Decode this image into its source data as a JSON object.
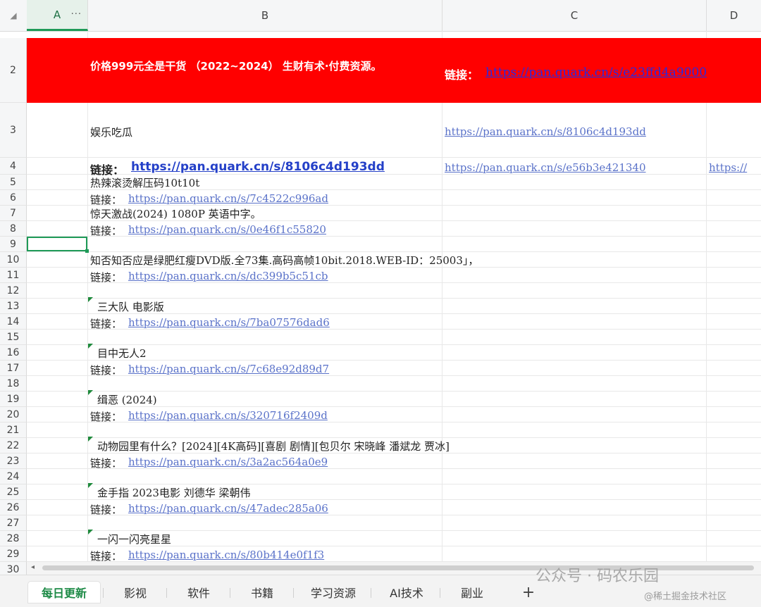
{
  "columns": [
    "A",
    "B",
    "C",
    "D"
  ],
  "col_a_menu": "···",
  "corner_icon": "◢",
  "rows": [
    "2",
    "3",
    "4",
    "5",
    "6",
    "7",
    "8",
    "9",
    "10",
    "11",
    "12",
    "13",
    "14",
    "15",
    "16",
    "17",
    "18",
    "19",
    "20",
    "21",
    "22",
    "23",
    "24",
    "25",
    "26",
    "27",
    "28",
    "29",
    "30"
  ],
  "banner": {
    "title": "价格999元全是干货 （2022~2024） 生财有术·付费资源。",
    "link_label": "链接：",
    "link_url": "https://pan.quark.cn/s/e23ffd4a9000",
    "color": "#ff0000"
  },
  "row3": {
    "text": "娱乐吃瓜",
    "c_link": "https://pan.quark.cn/s/8106c4d193dd"
  },
  "row4": {
    "label": "链接：",
    "b_link": "https://pan.quark.cn/s/8106c4d193dd",
    "c_link": "https://pan.quark.cn/s/e56b3e421340",
    "d_link": "https://"
  },
  "entries": [
    {
      "title": "热辣滚烫解压码10t10t",
      "label": "链接：",
      "url": "https://pan.quark.cn/s/7c4522c996ad"
    },
    {
      "title": "惊天激战(2024) 1080P 英语中字。",
      "label": "链接：",
      "url": "https://pan.quark.cn/s/0e46f1c55820"
    },
    {
      "title": "知否知否应是绿肥红瘦DVD版.全73集.高码高帧10bit.2018.WEB-ID：25003」，",
      "label": "链接：",
      "url": "https://pan.quark.cn/s/dc399b5c51cb"
    },
    {
      "title": "三大队 电影版",
      "label": "链接：",
      "url": "https://pan.quark.cn/s/7ba07576dad6"
    },
    {
      "title": "目中无人2",
      "label": "链接：",
      "url": "https://pan.quark.cn/s/7c68e92d89d7"
    },
    {
      "title": "缉恶 (2024)",
      "label": "链接：",
      "url": "https://pan.quark.cn/s/320716f2409d"
    },
    {
      "title": "动物园里有什么？[2024][4K高码][喜剧 剧情][包贝尔 宋晓峰 潘斌龙 贾冰]",
      "label": "链接：",
      "url": "https://pan.quark.cn/s/3a2ac564a0e9"
    },
    {
      "title": "金手指 2023电影 刘德华 梁朝伟",
      "label": "链接：",
      "url": "https://pan.quark.cn/s/47adec285a06"
    },
    {
      "title": "一闪一闪亮星星",
      "label": "链接：",
      "url": "https://pan.quark.cn/s/80b414e0f1f3"
    }
  ],
  "sheet_tabs": [
    "每日更新",
    "影视",
    "软件",
    "书籍",
    "学习资源",
    "AI技术",
    "副业"
  ],
  "active_tab": "每日更新",
  "add_tab_icon": "+",
  "watermark": "公众号 · 码农乐园",
  "watermark2": "@稀土掘金技术社区",
  "accent_color": "#1e9a57"
}
